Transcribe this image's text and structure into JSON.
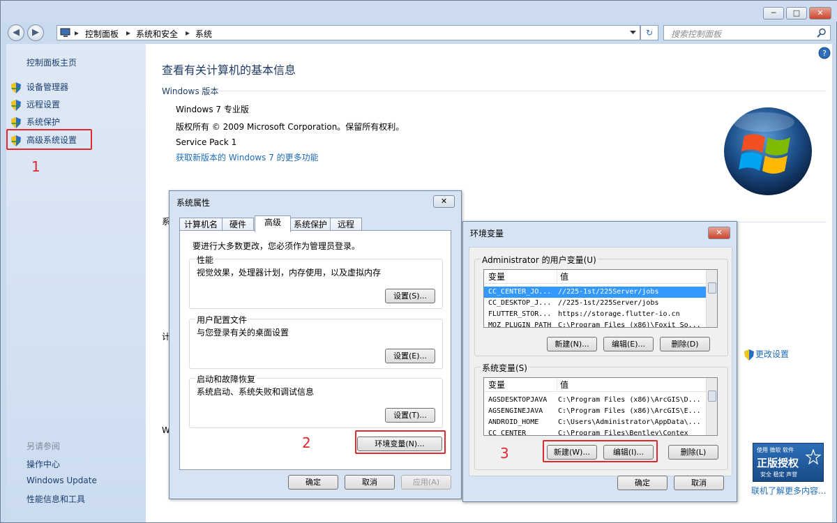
{
  "window": {
    "minimize_glyph": "─",
    "maximize_glyph": "□",
    "close_glyph": "✕"
  },
  "nav": {
    "back_glyph": "◀",
    "forward_glyph": "▶",
    "breadcrumb": [
      "控制面板",
      "系统和安全",
      "系统"
    ],
    "separator": "▸",
    "refresh_glyph": "↻",
    "search_placeholder": "搜索控制面板"
  },
  "sidebar": {
    "home": "控制面板主页",
    "items": [
      {
        "label": "设备管理器",
        "icon": "shield-icon"
      },
      {
        "label": "远程设置",
        "icon": "shield-icon"
      },
      {
        "label": "系统保护",
        "icon": "shield-icon"
      },
      {
        "label": "高级系统设置",
        "icon": "shield-icon"
      }
    ],
    "see_also_title": "另请参阅",
    "see_also": [
      "操作中心",
      "Windows Update",
      "性能信息和工具"
    ]
  },
  "main": {
    "title": "查看有关计算机的基本信息",
    "windows_edition_label": "Windows 版本",
    "edition": "Windows 7 专业版",
    "copyright": "版权所有 © 2009 Microsoft Corporation。保留所有权利。",
    "service_pack": "Service Pack 1",
    "more_features_link": "获取新版本的 Windows 7 的更多功能",
    "change_settings_link": "更改设置",
    "partial_left_chars": [
      "系",
      "计",
      "W"
    ],
    "genuine_badge": {
      "line1": "使用 微软 软件",
      "line2": "正版授权",
      "line3": "安全 稳定 声誉"
    },
    "learn_more_link": "联机了解更多内容..."
  },
  "annotations": [
    "1",
    "2",
    "3"
  ],
  "sysprops": {
    "title": "系统属性",
    "close_glyph": "✕",
    "tabs": [
      "计算机名",
      "硬件",
      "高级",
      "系统保护",
      "远程"
    ],
    "active_tab": "高级",
    "admin_note": "要进行大多数更改，您必须作为管理员登录。",
    "performance": {
      "label": "性能",
      "desc": "视觉效果，处理器计划，内存使用，以及虚拟内存",
      "button": "设置(S)..."
    },
    "profiles": {
      "label": "用户配置文件",
      "desc": "与您登录有关的桌面设置",
      "button": "设置(E)..."
    },
    "startup": {
      "label": "启动和故障恢复",
      "desc": "系统启动、系统失败和调试信息",
      "button": "设置(T)..."
    },
    "env_button": "环境变量(N)...",
    "ok": "确定",
    "cancel": "取消",
    "apply": "应用(A)"
  },
  "envvars": {
    "title": "环境变量",
    "close_glyph": "✕",
    "user_group": "Administrator 的用户变量(U)",
    "system_group": "系统变量(S)",
    "col_var": "变量",
    "col_val": "值",
    "user_vars": [
      {
        "name": "CC_CENTER_JO...",
        "value": "//225-1st/225Server/jobs"
      },
      {
        "name": "CC_DESKTOP_J...",
        "value": "//225-1st/225Server/jobs"
      },
      {
        "name": "FLUTTER_STOR...",
        "value": "https://storage.flutter-io.cn"
      },
      {
        "name": "MOZ_PLUGIN_PATH",
        "value": "C:\\Program Files (x86)\\Foxit So..."
      }
    ],
    "system_vars": [
      {
        "name": "AGSDESKTOPJAVA",
        "value": "C:\\Program Files (x86)\\ArcGIS\\D..."
      },
      {
        "name": "AGSENGINEJAVA",
        "value": "C:\\Program Files (x86)\\ArcGIS\\E..."
      },
      {
        "name": "ANDROID_HOME",
        "value": "C:\\Users\\Administrator\\AppData\\..."
      },
      {
        "name": "CC_CENTER",
        "value": "C:\\Program Files\\Bentley\\Contex"
      }
    ],
    "user_buttons": {
      "new": "新建(N)...",
      "edit": "编辑(E)...",
      "delete": "删除(D)"
    },
    "system_buttons": {
      "new": "新建(W)...",
      "edit": "编辑(I)...",
      "delete": "删除(L)"
    },
    "ok": "确定",
    "cancel": "取消"
  },
  "colors": {
    "annotation_red": "#e0282d",
    "link_blue": "#1e6bb8",
    "selection_blue": "#3399ff"
  }
}
